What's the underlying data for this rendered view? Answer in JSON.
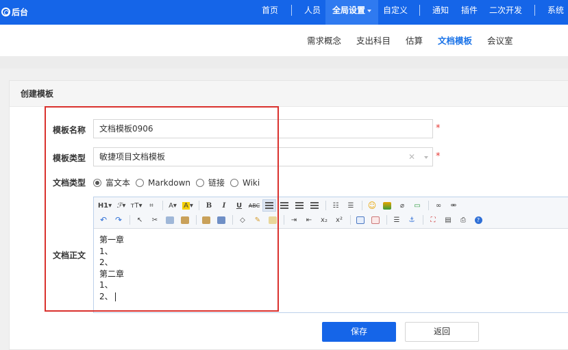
{
  "topbar": {
    "brand": "后台",
    "nav": [
      {
        "label": "首页"
      },
      {
        "label": "人员"
      },
      {
        "label": "全局设置"
      },
      {
        "label": "自定义"
      },
      {
        "label": "通知"
      },
      {
        "label": "插件"
      },
      {
        "label": "二次开发"
      },
      {
        "label": "系统"
      }
    ],
    "active": "全局设置"
  },
  "subnav": {
    "items": [
      "需求概念",
      "支出科目",
      "估算",
      "文档模板",
      "会议室"
    ],
    "active": "文档模板"
  },
  "panel": {
    "title": "创建模板"
  },
  "form": {
    "name_label": "模板名称",
    "name_value": "文档模板0906",
    "type_label": "模板类型",
    "type_value": "敏捷项目文档模板",
    "doc_type_label": "文档类型",
    "doc_type_options": [
      "富文本",
      "Markdown",
      "链接",
      "Wiki"
    ],
    "doc_type_selected": "富文本",
    "content_label": "文档正文",
    "required_mark": "*"
  },
  "editor": {
    "toolbar_row1": [
      "h1-icon",
      "font-family-icon",
      "font-size-icon",
      "paragraph-icon",
      "font-color-icon",
      "highlight-icon",
      "bold-icon",
      "italic-icon",
      "underline-icon",
      "strikethrough-icon",
      "align-left-icon",
      "align-center-icon",
      "align-right-icon",
      "justify-icon",
      "ordered-list-icon",
      "unordered-list-icon",
      "emoji-icon",
      "image-icon",
      "attachment-icon",
      "insert-code-icon",
      "link-icon",
      "unlink-icon"
    ],
    "toolbar_row2": [
      "undo-icon",
      "redo-icon",
      "select-icon",
      "cut-icon",
      "copy-icon",
      "paste-icon",
      "paste-text-icon",
      "paste-word-icon",
      "eraser-icon",
      "format-brush-icon",
      "preview-icon",
      "indent-icon",
      "outdent-icon",
      "subscript-icon",
      "superscript-icon",
      "table-icon",
      "template-icon",
      "page-break-icon",
      "anchor-icon",
      "fullscreen-icon",
      "source-icon",
      "print-icon",
      "help-icon"
    ],
    "lines": [
      "第一章",
      "1、",
      "2、",
      "第二章",
      "1、",
      "2、"
    ]
  },
  "buttons": {
    "save": "保存",
    "back": "返回"
  },
  "colors": {
    "primary": "#1565e8",
    "annotation": "#d9302c",
    "required": "#e53935"
  }
}
